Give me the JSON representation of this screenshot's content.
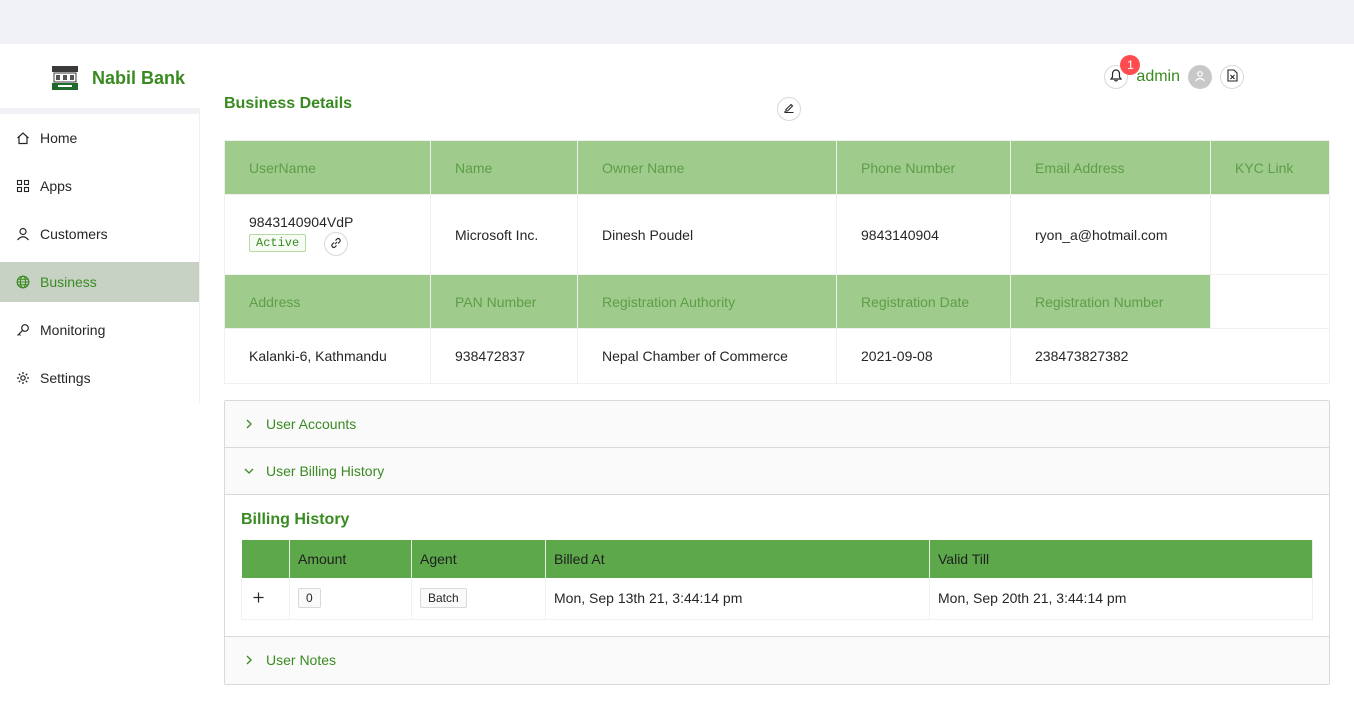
{
  "header": {
    "brand": "Nabil Bank",
    "notification_count": "1",
    "user": "admin"
  },
  "sidebar": {
    "items": [
      {
        "label": "Home",
        "icon": "home-icon"
      },
      {
        "label": "Apps",
        "icon": "apps-icon"
      },
      {
        "label": "Customers",
        "icon": "user-icon"
      },
      {
        "label": "Business",
        "icon": "globe-icon",
        "active": true
      },
      {
        "label": "Monitoring",
        "icon": "key-icon"
      },
      {
        "label": "Settings",
        "icon": "gear-icon"
      }
    ]
  },
  "business": {
    "title": "Business Details",
    "headers1": [
      "UserName",
      "Name",
      "Owner Name",
      "Phone Number",
      "Email Address",
      "KYC Link"
    ],
    "row1": {
      "username": "9843140904VdP",
      "status": "Active",
      "name": "Microsoft Inc.",
      "owner": "Dinesh Poudel",
      "phone": "9843140904",
      "email": "ryon_a@hotmail.com",
      "kyc": ""
    },
    "headers2": [
      "Address",
      "PAN Number",
      "Registration Authority",
      "Registration Date",
      "Registration Number"
    ],
    "row2": {
      "address": "Kalanki-6, Kathmandu",
      "pan": "938472837",
      "authority": "Nepal Chamber of Commerce",
      "reg_date": "2021-09-08",
      "reg_number": "238473827382"
    }
  },
  "panels": {
    "user_accounts": "User Accounts",
    "billing_history": "User Billing History",
    "user_notes": "User Notes"
  },
  "billing": {
    "title": "Billing History",
    "columns": [
      "",
      "Amount",
      "Agent",
      "Billed At",
      "Valid Till"
    ],
    "rows": [
      {
        "amount": "0",
        "agent": "Batch",
        "billed_at": "Mon, Sep 13th 21, 3:44:14 pm",
        "valid_till": "Mon, Sep 20th 21, 3:44:14 pm"
      }
    ]
  },
  "colors": {
    "brand_green": "#3a8a22",
    "header_green": "#9fcb8d",
    "table_head_green": "#5ca84a",
    "active_nav": "#c7d2c4"
  }
}
